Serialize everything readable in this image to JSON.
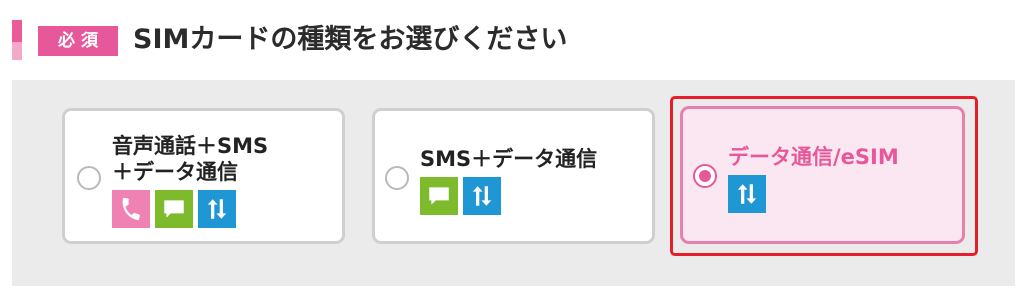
{
  "header": {
    "required_badge": "必須",
    "title": "SIMカードの種類をお選びください"
  },
  "options": [
    {
      "label_line1": "音声通話＋SMS",
      "label_line2": "＋データ通信",
      "selected": false,
      "icons": [
        "phone-icon",
        "sms-icon",
        "data-icon"
      ]
    },
    {
      "label_line1": "SMS＋データ通信",
      "selected": false,
      "icons": [
        "sms-icon",
        "data-icon"
      ]
    },
    {
      "label_line1": "データ通信/eSIM",
      "selected": true,
      "icons": [
        "data-icon"
      ]
    }
  ],
  "colors": {
    "accent_pink": "#e7589a",
    "voice_icon": "#ef82b3",
    "sms_icon": "#7dbb2c",
    "data_icon": "#1f97d4",
    "selected_bg": "#fbe7f1",
    "highlight_outline": "#e61d2a",
    "panel_bg": "#ebebeb"
  }
}
